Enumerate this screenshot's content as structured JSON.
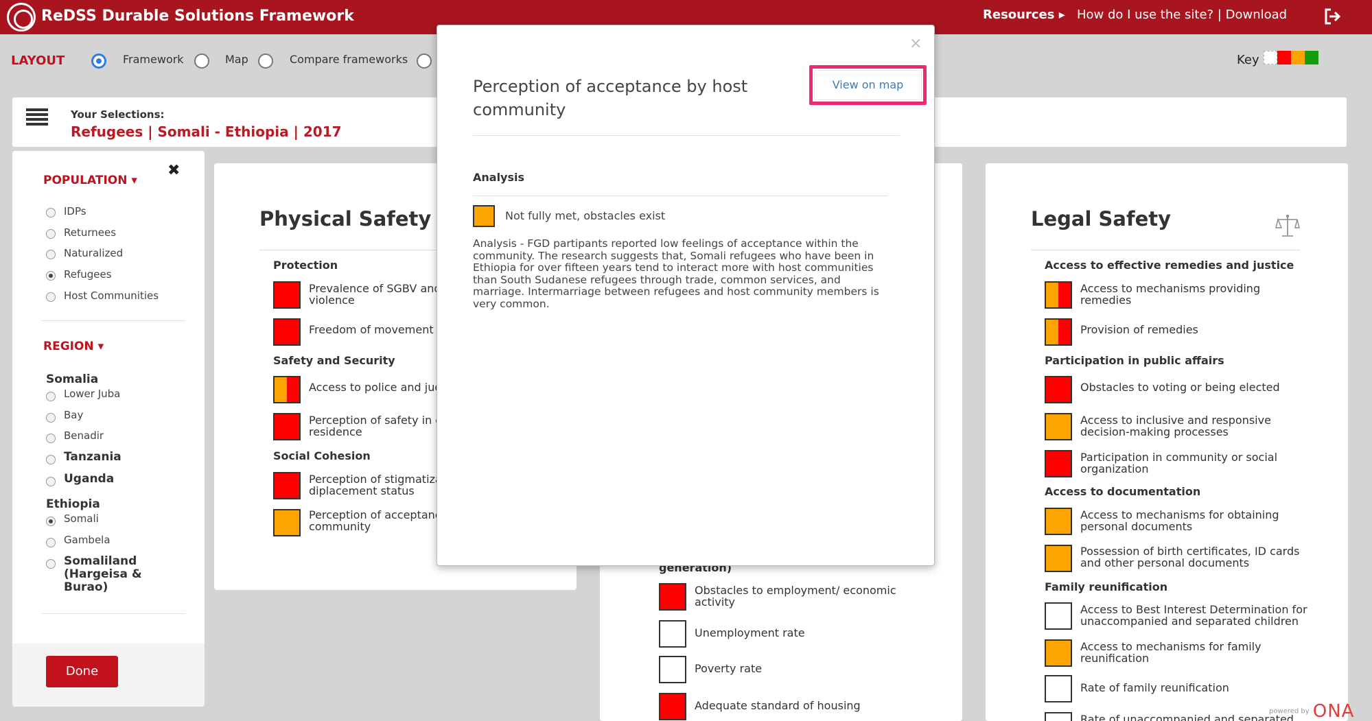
{
  "app": {
    "title": "ReDSS Durable Solutions Framework",
    "resources_label": "Resources ▸",
    "help_links": "How do I use the site? | Download"
  },
  "layout": {
    "label": "LAYOUT",
    "options": [
      "Framework",
      "Map",
      "Compare frameworks"
    ],
    "selected": "Framework",
    "key_label": "Key"
  },
  "selection": {
    "title": "Your Selections:",
    "value": "Refugees | Somali - Ethiopia | 2017"
  },
  "sidebar": {
    "population_heading": "POPULATION",
    "population_options": [
      "IDPs",
      "Returnees",
      "Naturalized",
      "Refugees",
      "Host Communities"
    ],
    "population_selected": "Refugees",
    "region_heading": "REGION",
    "somalia": "Somalia",
    "somalia_regions": [
      "Lower Juba",
      "Bay",
      "Benadir"
    ],
    "tanzania": "Tanzania",
    "uganda": "Uganda",
    "ethiopia": "Ethiopia",
    "ethiopia_regions": [
      "Somali",
      "Gambela"
    ],
    "ethiopia_selected": "Somali",
    "somaliland": "Somaliland (Hargeisa & Burao)",
    "done_label": "Done"
  },
  "colors": {
    "brand": "#a8151f",
    "red": "#fe0000",
    "orange": "#fea400",
    "green": "#139d0c",
    "link_blue": "#3b7cb6",
    "highlight_pink": "#ec2a73"
  },
  "physical_safety": {
    "title": "Physical Safety",
    "categories": [
      "Protection",
      "Safety and Security",
      "Social Cohesion"
    ],
    "indicators": [
      {
        "label": "Prevalence of SGBV and violence",
        "status": "red"
      },
      {
        "label": "Freedom of movement",
        "status": "red"
      },
      {
        "label": "Access to police and jud",
        "status": "orange-red"
      },
      {
        "label": "Perception of safety in c residence",
        "status": "red"
      },
      {
        "label": "Perception of stigmatiza diplacement status",
        "status": "red"
      },
      {
        "label": "Perception of acceptanc community",
        "status": "orange"
      }
    ]
  },
  "material_safety": {
    "partial_category": "generation)",
    "indicators": [
      {
        "label": "Obstacles to employment/ economic activity",
        "status": "red"
      },
      {
        "label": "Unemployment rate",
        "status": "empty"
      },
      {
        "label": "Poverty rate",
        "status": "empty"
      },
      {
        "label": "Adequate standard of housing",
        "status": "red"
      }
    ]
  },
  "legal_safety": {
    "title": "Legal Safety",
    "categories": [
      "Access to effective remedies and justice",
      "Participation in public affairs",
      "Access to documentation",
      "Family reunification"
    ],
    "indicators": [
      {
        "label": "Access to mechanisms providing remedies",
        "status": "orange-red"
      },
      {
        "label": "Provision of remedies",
        "status": "orange-red"
      },
      {
        "label": "Obstacles to voting or being elected",
        "status": "red"
      },
      {
        "label": "Access to inclusive and responsive decision-making processes",
        "status": "orange"
      },
      {
        "label": "Participation in community or social organization",
        "status": "red"
      },
      {
        "label": "Access to mechanisms for obtaining personal documents",
        "status": "orange"
      },
      {
        "label": "Possession of birth certificates, ID cards and other personal documents",
        "status": "orange"
      },
      {
        "label": "Access to Best Interest Determination for unaccompanied and separated children",
        "status": "empty"
      },
      {
        "label": "Access to mechanisms for family reunification",
        "status": "orange"
      },
      {
        "label": "Rate of family reunification",
        "status": "empty"
      },
      {
        "label": "Rate of unaccompanied and separated",
        "status": "empty"
      }
    ]
  },
  "modal": {
    "close": "×",
    "title": "Perception of acceptance by host community",
    "view_on_map": "View on map",
    "analysis_heading": "Analysis",
    "status_label": "Not fully met, obstacles exist",
    "status": "orange",
    "analysis_text": "Analysis -  FGD partipants reported low feelings of acceptance within the community. The research suggests that, Somali refugees who have been in Ethiopia for over fifteen years tend to interact more with host communities than South Sudanese refugees through trade, common services, and marriage. Intermarriage between refugees and host community members is very common."
  },
  "footer": {
    "powered_by": "powered by",
    "ona": "ONA"
  }
}
